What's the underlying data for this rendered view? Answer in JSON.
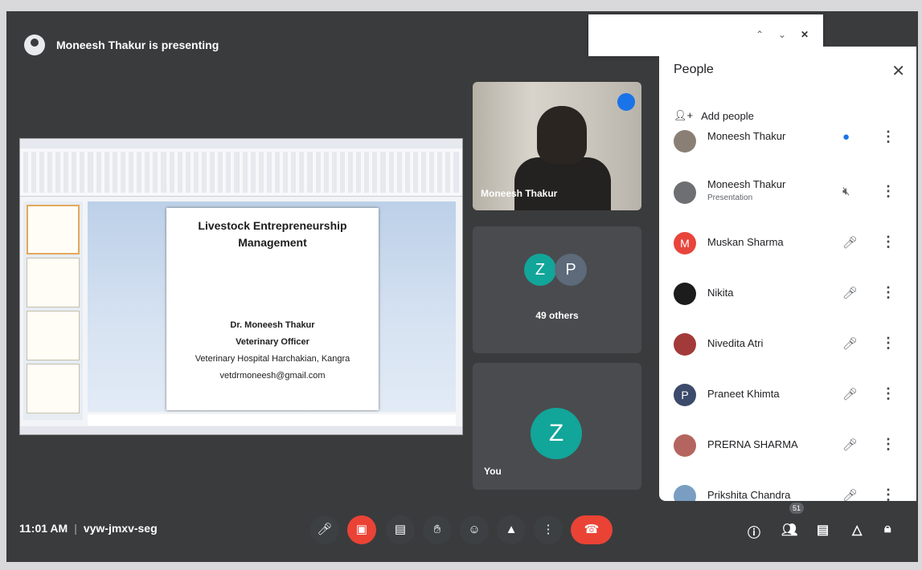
{
  "header": {
    "presenting_text": "Moneesh Thakur is presenting"
  },
  "presentation": {
    "slide_title": "Livestock Entrepreneurship Management",
    "slide_lines": [
      "Dr. Moneesh Thakur",
      "Veterinary Officer",
      "Veterinary Hospital Harchakian, Kangra",
      "vetdrmoneesh@gmail.com"
    ]
  },
  "tiles": {
    "camera_label": "Moneesh Thakur",
    "others_initials": [
      "Z",
      "P"
    ],
    "others_label": "49 others",
    "you_initial": "Z",
    "you_label": "You"
  },
  "people_panel": {
    "title": "People",
    "add_people_label": "Add people",
    "participants": [
      {
        "name": "Moneesh Thakur",
        "subtitle": "",
        "avatar_text": "",
        "avatar_color": "#8a7f75",
        "mic_state": "speaking"
      },
      {
        "name": "Moneesh Thakur",
        "subtitle": "Presentation",
        "avatar_text": "",
        "avatar_color": "#6d6f73",
        "mic_state": "presenting"
      },
      {
        "name": "Muskan Sharma",
        "subtitle": "",
        "avatar_text": "M",
        "avatar_color": "#e8453c",
        "mic_state": "muted"
      },
      {
        "name": "Nikita",
        "subtitle": "",
        "avatar_text": "",
        "avatar_color": "#1c1c1c",
        "mic_state": "muted"
      },
      {
        "name": "Nivedita Atri",
        "subtitle": "",
        "avatar_text": "",
        "avatar_color": "#a33a3a",
        "mic_state": "muted"
      },
      {
        "name": "Praneet Khimta",
        "subtitle": "",
        "avatar_text": "P",
        "avatar_color": "#3c4a6b",
        "mic_state": "muted"
      },
      {
        "name": "PRERNA SHARMA",
        "subtitle": "",
        "avatar_text": "",
        "avatar_color": "#b5655f",
        "mic_state": "muted"
      },
      {
        "name": "Prikshita Chandra",
        "subtitle": "",
        "avatar_text": "",
        "avatar_color": "#7a9ec2",
        "mic_state": "muted"
      }
    ]
  },
  "bottom_bar": {
    "time": "11:01 AM",
    "meeting_code": "vyw-jmxv-seg",
    "participant_count": "51"
  },
  "colors": {
    "accent": "#1a73e8",
    "danger": "#ea4335",
    "teal": "#12a59a"
  }
}
